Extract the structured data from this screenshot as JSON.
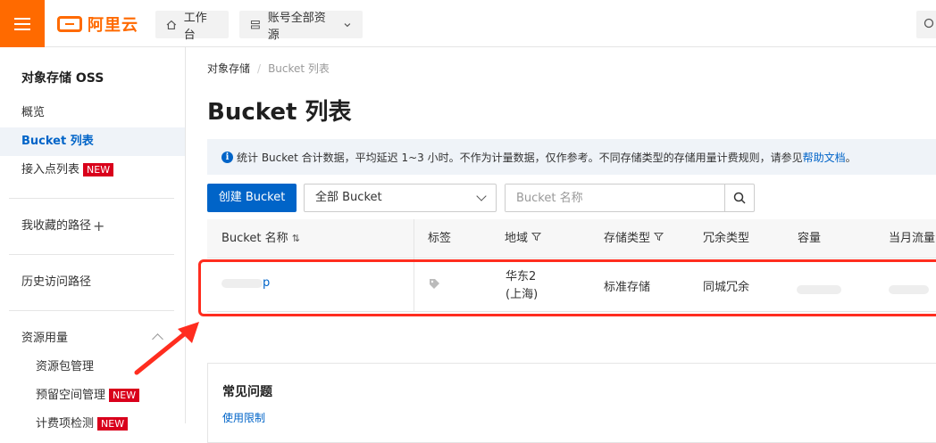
{
  "header": {
    "logo_text": "阿里云",
    "workbench_label": "工作台",
    "resources_label": "账号全部资源"
  },
  "sidebar": {
    "title": "对象存储 OSS",
    "items": [
      {
        "label": "概览"
      },
      {
        "label": "Bucket 列表"
      },
      {
        "label": "接入点列表",
        "badge": "NEW"
      },
      {
        "label": "我收藏的路径"
      },
      {
        "label": "历史访问路径"
      },
      {
        "label": "资源用量"
      },
      {
        "label": "资源包管理"
      },
      {
        "label": "预留空间管理",
        "badge": "NEW"
      },
      {
        "label": "计费项检测",
        "badge": "NEW"
      }
    ]
  },
  "breadcrumb": {
    "root": "对象存储",
    "current": "Bucket 列表"
  },
  "page_title": "Bucket 列表",
  "notice": {
    "text": "统计 Bucket 合计数据，平均延迟 1~3 小时。不作为计量数据，仅作参考。不同存储类型的存储用量计费规则，请参见",
    "link": "帮助文档",
    "suffix": "。"
  },
  "toolbar": {
    "create_label": "创建 Bucket",
    "filter_selected": "全部 Bucket",
    "search_placeholder": "Bucket 名称"
  },
  "table": {
    "columns": [
      "Bucket 名称",
      "标签",
      "地域",
      "存储类型",
      "冗余类型",
      "容量",
      "当月流量"
    ],
    "rows": [
      {
        "name": "p",
        "region_line1": "华东2",
        "region_line2": "(上海)",
        "storage_type": "标准存储",
        "redundancy": "同城冗余"
      }
    ]
  },
  "faq": {
    "title": "常见问题",
    "link": "使用限制"
  },
  "colors": {
    "brand_orange": "#ff6a00",
    "primary_blue": "#0064c8",
    "highlight_red": "#ff2d1f",
    "badge_red": "#d9001b"
  }
}
